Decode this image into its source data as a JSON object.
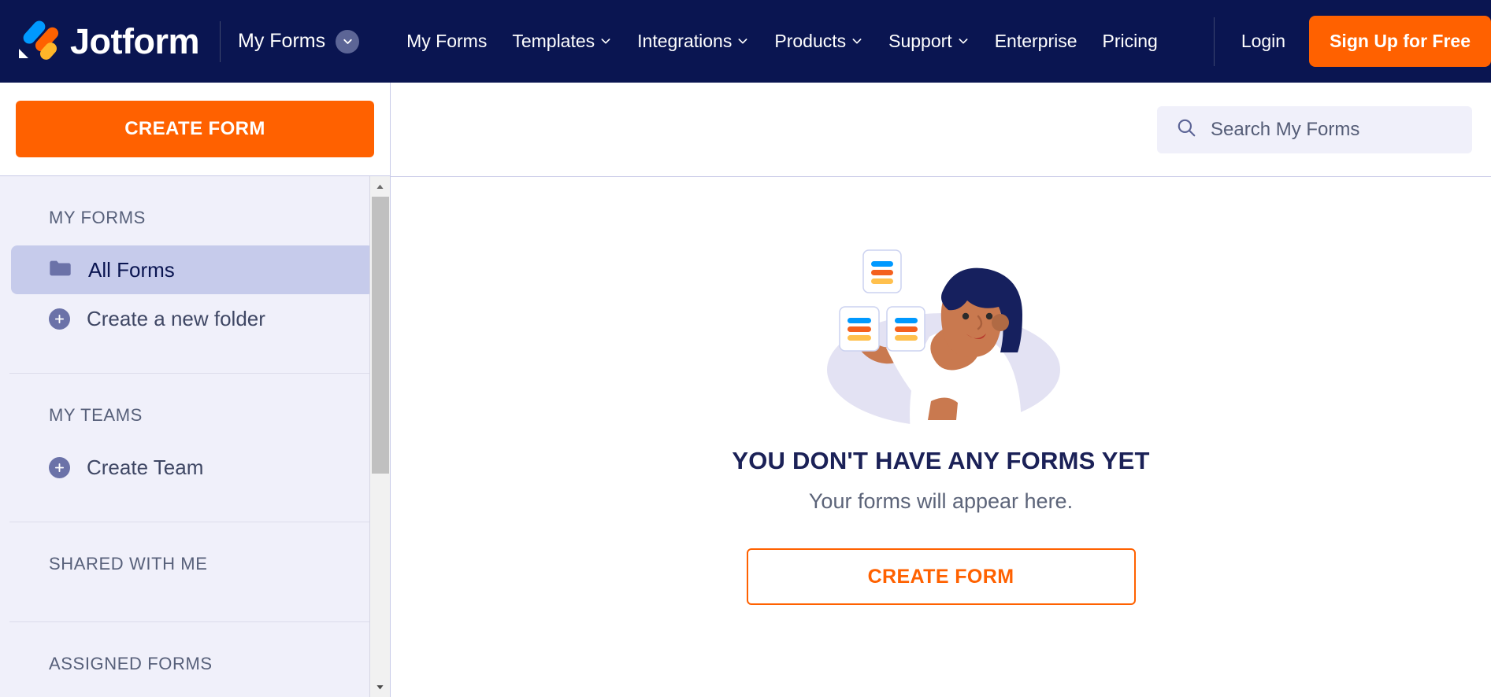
{
  "brand": {
    "name": "Jotform",
    "logo_icon": "jotform-logo-icon"
  },
  "header": {
    "workspace_switch_label": "My Forms",
    "workspace_switch_icon": "chevron-down-icon",
    "nav_links": [
      {
        "label": "My Forms",
        "has_caret": false
      },
      {
        "label": "Templates",
        "has_caret": true
      },
      {
        "label": "Integrations",
        "has_caret": true
      },
      {
        "label": "Products",
        "has_caret": true
      },
      {
        "label": "Support",
        "has_caret": true
      },
      {
        "label": "Enterprise",
        "has_caret": false
      },
      {
        "label": "Pricing",
        "has_caret": false
      }
    ],
    "login_label": "Login",
    "signup_label": "Sign Up for Free"
  },
  "sidebar": {
    "create_form_label": "CREATE FORM",
    "sections": [
      {
        "heading": "MY FORMS",
        "items": [
          {
            "label": "All Forms",
            "icon": "folder-icon",
            "active": true
          },
          {
            "label": "Create a new folder",
            "icon": "plus-circle-icon",
            "active": false
          }
        ]
      },
      {
        "heading": "MY TEAMS",
        "items": [
          {
            "label": "Create Team",
            "icon": "plus-circle-icon",
            "active": false
          }
        ]
      },
      {
        "heading": "SHARED WITH ME",
        "items": []
      },
      {
        "heading": "ASSIGNED FORMS",
        "items": []
      }
    ],
    "scrollbar": {
      "up_icon": "caret-up-icon",
      "down_icon": "caret-down-icon"
    }
  },
  "main": {
    "search": {
      "placeholder": "Search My Forms",
      "value": "",
      "icon": "search-icon"
    },
    "empty_state": {
      "illustration": "woman-holding-form-cards-illustration",
      "title": "YOU DON'T HAVE ANY FORMS YET",
      "subtitle": "Your forms will appear here.",
      "cta_label": "CREATE FORM"
    }
  },
  "colors": {
    "nav_background": "#0a1551",
    "accent_orange": "#ff6100",
    "sidebar_background": "#f0f0fa",
    "active_item_background": "#c6cbeb",
    "heading_navy": "#1b2157"
  }
}
